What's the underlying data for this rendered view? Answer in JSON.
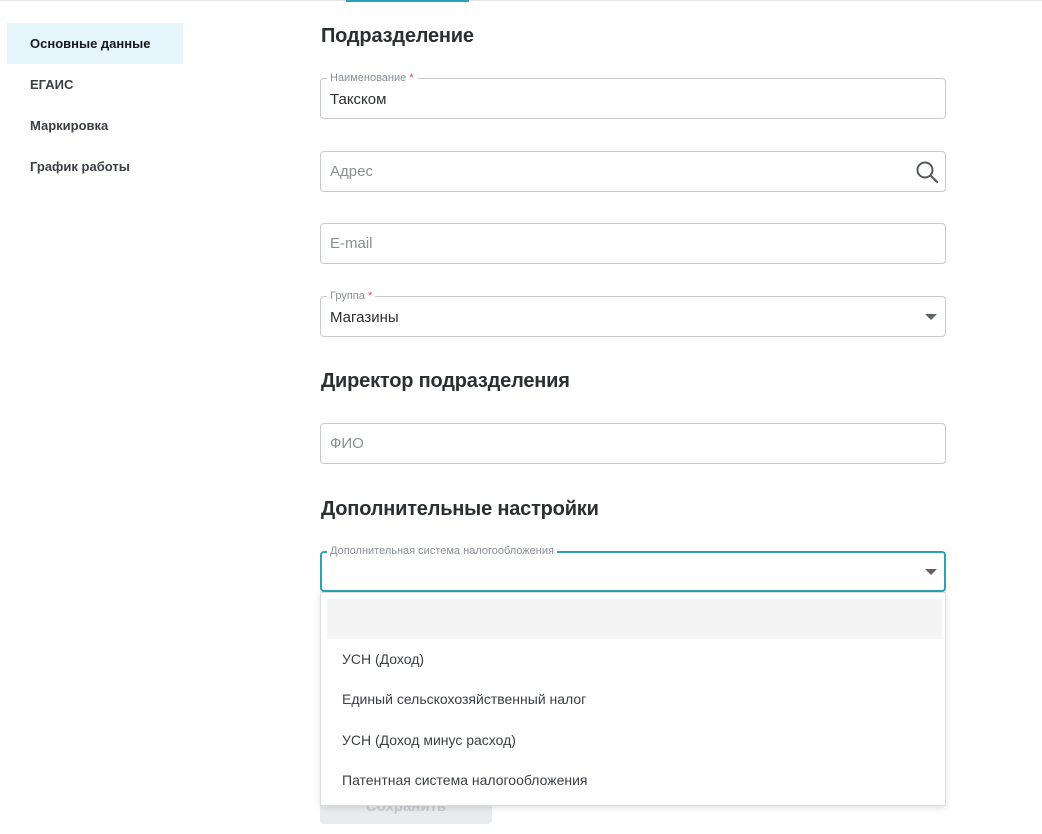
{
  "sidebar": {
    "items": [
      {
        "label": "Основные данные",
        "active": true
      },
      {
        "label": "ЕГАИС",
        "active": false
      },
      {
        "label": "Маркировка",
        "active": false
      },
      {
        "label": "График работы",
        "active": false
      }
    ]
  },
  "sections": {
    "division_title": "Подразделение",
    "director_title": "Директор подразделения",
    "additional_title": "Дополнительные настройки"
  },
  "fields": {
    "name": {
      "label": "Наименование",
      "required_mark": "*",
      "value": "Такском"
    },
    "address": {
      "placeholder": "Адрес",
      "icon": "search-icon"
    },
    "email": {
      "placeholder": "E-mail"
    },
    "group": {
      "label": "Группа",
      "required_mark": "*",
      "value": "Магазины"
    },
    "fio": {
      "placeholder": "ФИО"
    },
    "tax_system": {
      "label": "Дополнительная система налогообложения",
      "value": ""
    }
  },
  "dropdown": {
    "options": [
      "УСН (Доход)",
      "Единый сельскохозяйственный налог",
      "УСН (Доход минус расход)",
      "Патентная система налогообложения"
    ]
  },
  "actions": {
    "save_label": "Сохранить"
  },
  "colors": {
    "accent": "#2ba3b0",
    "active_sidebar_bg": "#e6f4fb",
    "required": "#e0453b"
  }
}
